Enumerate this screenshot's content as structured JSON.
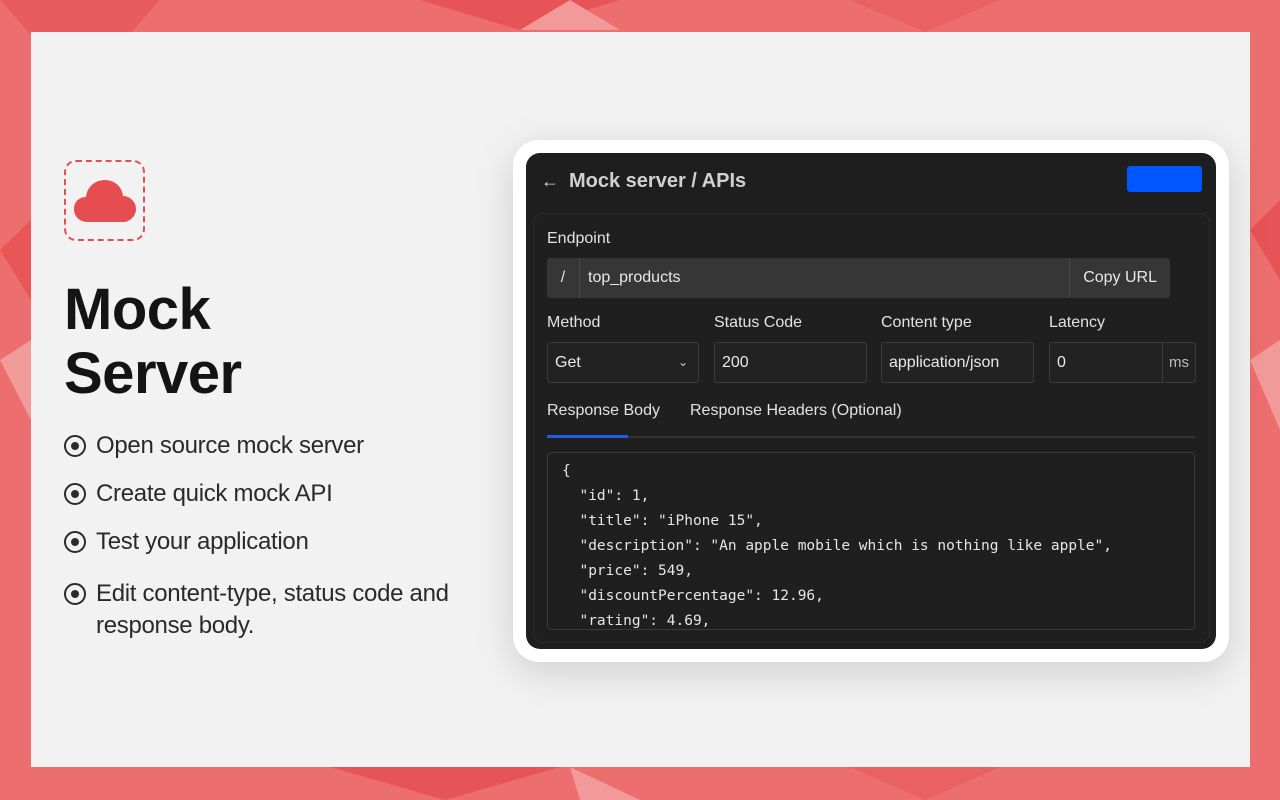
{
  "colors": {
    "background": "#ec6e6e",
    "card": "#f2f2f2",
    "accent": "#e64d51",
    "primary": "#0057ff",
    "tab_indicator": "#1f5fe0"
  },
  "logo": {
    "icon": "cloud-icon"
  },
  "headline": {
    "line1": "Mock",
    "line2": "Server"
  },
  "features": [
    "Open source mock server",
    "Create quick mock API",
    "Test your application",
    "Edit content-type, status code and response body."
  ],
  "app": {
    "back_icon": "←",
    "title": "Mock server / APIs",
    "endpoint": {
      "label": "Endpoint",
      "prefix": "/",
      "value": "top_products",
      "copy_label": "Copy URL"
    },
    "method": {
      "label": "Method",
      "value": "Get"
    },
    "status_code": {
      "label": "Status Code",
      "value": "200"
    },
    "content_type": {
      "label": "Content type",
      "value": "application/json"
    },
    "latency": {
      "label": "Latency",
      "value": "0",
      "unit": "ms"
    },
    "tabs": [
      {
        "label": "Response Body",
        "active": true
      },
      {
        "label": "Response Headers (Optional)",
        "active": false
      }
    ],
    "response_body_lines": [
      "{",
      "  \"id\": 1,",
      "  \"title\": \"iPhone 15\",",
      "  \"description\": \"An apple mobile which is nothing like apple\",",
      "  \"price\": 549,",
      "  \"discountPercentage\": 12.96,",
      "  \"rating\": 4.69,"
    ]
  }
}
